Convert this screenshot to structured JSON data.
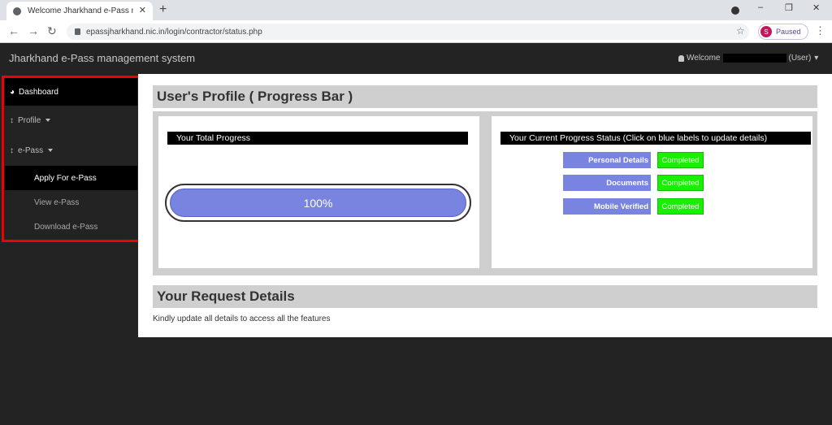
{
  "browser": {
    "tab_title": "Welcome Jharkhand e-Pass mana",
    "tab_close": "✕",
    "new_tab": "+",
    "url": "epassjharkhand.nic.in/login/contractor/status.php",
    "profile_initial": "S",
    "profile_status": "Paused",
    "back": "←",
    "forward": "→",
    "reload": "↻",
    "star": "☆",
    "menu": "⋮",
    "minimize": "–",
    "restore": "❐",
    "close": "✕"
  },
  "header": {
    "brand": "Jharkhand e-Pass management system",
    "welcome": "Welcome",
    "user_suffix": "(User)",
    "caret": "▾"
  },
  "sidebar": {
    "dashboard": "Dashboard",
    "profile": "Profile",
    "epass": "e-Pass",
    "apply": "Apply For e-Pass",
    "view": "View e-Pass",
    "download": "Download e-Pass"
  },
  "main": {
    "profile_heading": "User's Profile ( Progress Bar )",
    "total_progress_title": "Your Total Progress",
    "progress_text": "100%",
    "progress_fraction": 1.0,
    "status_title": "Your Current Progress Status (Click on blue labels to update details)",
    "status_rows": [
      {
        "label": "Personal Details",
        "status": "Completed"
      },
      {
        "label": "Documents",
        "status": "Completed"
      },
      {
        "label": "Mobile Verified",
        "status": "Completed"
      }
    ],
    "request_heading": "Your Request Details",
    "request_note": "Kindly update all details to access all the features"
  },
  "colors": {
    "accent_blue": "#7884e0",
    "success_green": "#17f000",
    "highlight_red": "#f20000"
  }
}
